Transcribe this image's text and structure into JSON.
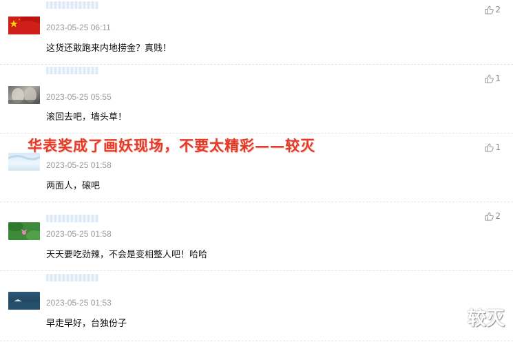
{
  "banner": "华表奖成了画妖现场，不要太精彩——较灭",
  "watermark": "较灭",
  "comments": [
    {
      "time": "2023-05-25 06:11",
      "text": "这货还敢跑来内地捞金？真贱！",
      "likes": "2",
      "avatar": "flag-avatar"
    },
    {
      "time": "2023-05-25 05:55",
      "text": "滚回去吧，墙头草！",
      "likes": "1",
      "avatar": "photo-avatar"
    },
    {
      "time": "2023-05-25 01:58",
      "text": "两面人，磙吧",
      "likes": "1",
      "avatar": "sky-avatar"
    },
    {
      "time": "2023-05-25 01:58",
      "text": "天天要吃劲辣，不会是变相整人吧！哈哈",
      "likes": "2",
      "avatar": "lotus-avatar"
    },
    {
      "time": "2023-05-25 01:53",
      "text": "早走早好，台独份子",
      "likes": "",
      "avatar": "sea-avatar"
    }
  ]
}
